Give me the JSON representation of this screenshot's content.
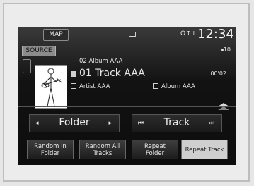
{
  "topbar": {
    "map_label": "MAP",
    "clock": "12:34",
    "bluetooth": "ʘ",
    "signal": "T.ıl"
  },
  "source": {
    "label": "SOURCE",
    "volume": "◂10"
  },
  "now_playing": {
    "folder": "02 Album AAA",
    "track": "01 Track AAA",
    "artist": "Artist AAA",
    "album": "Album AAA",
    "elapsed": "00'02"
  },
  "controls": {
    "folder": {
      "label": "Folder",
      "prev": "◂",
      "next": "▸"
    },
    "track": {
      "label": "Track",
      "prev": "⏮",
      "next": "⏭"
    }
  },
  "bottom_buttons": [
    {
      "label_line1": "Random in",
      "label_line2": "Folder"
    },
    {
      "label_line1": "Random All",
      "label_line2": "Tracks"
    },
    {
      "label_line1": "Repeat",
      "label_line2": "Folder"
    },
    {
      "label_line1": "Repeat Track",
      "label_line2": ""
    }
  ],
  "colors": {
    "screen_bg": "#121212",
    "selected_button": "#cfcfcf",
    "text": "#e6e6e6"
  }
}
